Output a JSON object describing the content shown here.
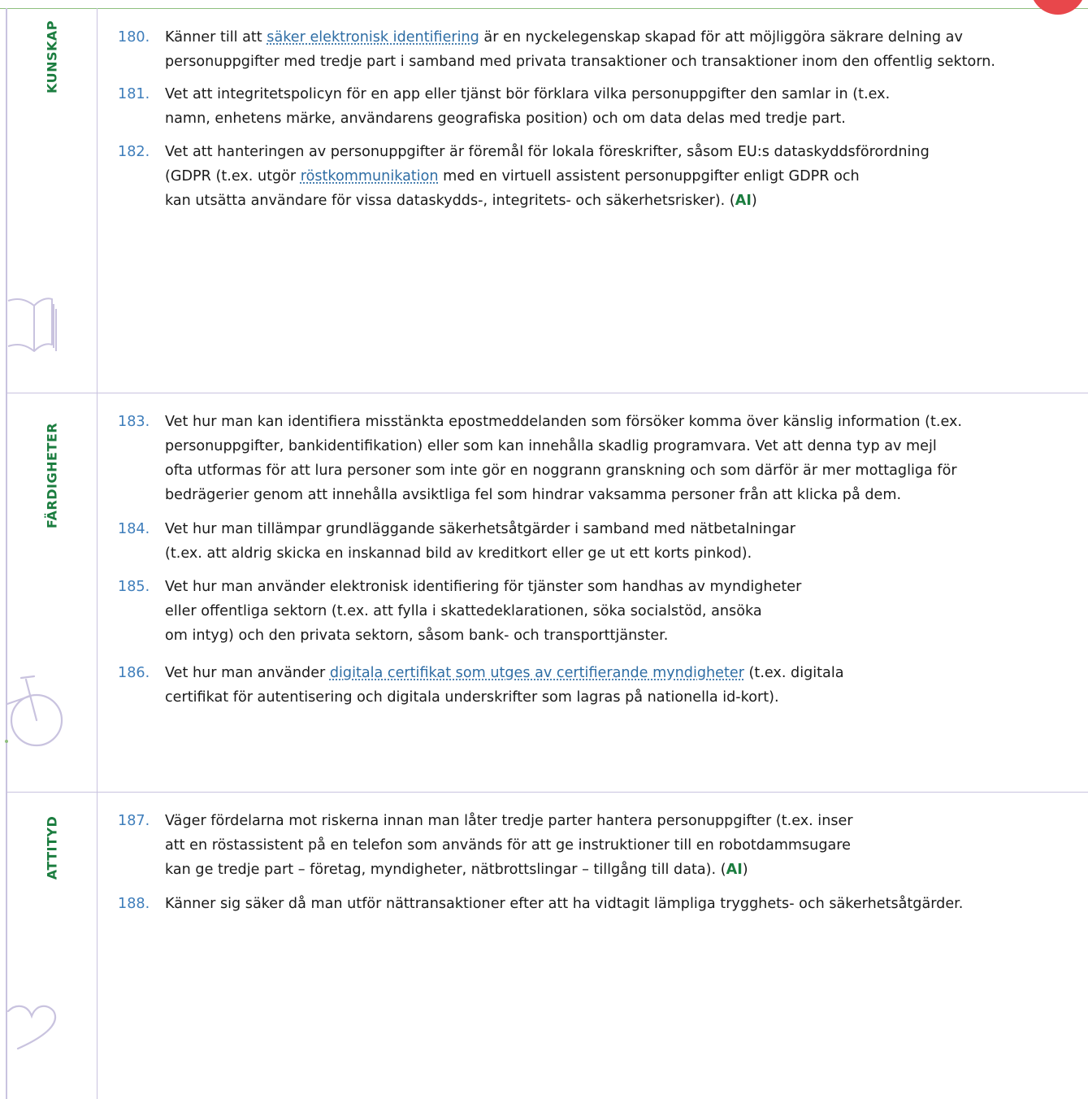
{
  "sections": {
    "kunskap": {
      "label": "KUNSKAP",
      "icon": "book-icon"
    },
    "fardigheter": {
      "label": "FÄRDIGHETER",
      "icon": "bicycle-icon"
    },
    "attityd": {
      "label": "ATTITYD",
      "icon": "heart-icon"
    }
  },
  "items": {
    "i180": {
      "num": "180.",
      "l1a": "Känner till att ",
      "l1link": "säker elektronisk identifiering",
      "l1b": " är en nyckelegenskap skapad för att möjliggöra säkrare delning av",
      "l2": "personuppgifter med tredje part i samband med privata transaktioner och transaktioner inom den offentlig sektorn."
    },
    "i181": {
      "num": "181.",
      "l1": "Vet att integritetspolicyn för en app eller tjänst bör förklara vilka personuppgifter den samlar in (t.ex.",
      "l2": "namn, enhetens märke, användarens geografiska position) och om data delas med tredje part."
    },
    "i182": {
      "num": "182.",
      "l1": "Vet att hanteringen av personuppgifter är föremål för lokala föreskrifter, såsom EU:s dataskyddsförordning",
      "l2a": "(GDPR (t.ex. utgör ",
      "l2link": "röstkommunikation",
      "l2b": " med en virtuell assistent personuppgifter enligt GDPR och",
      "l3a": "kan utsätta användare för vissa dataskydds-, integritets- och säkerhetsrisker). (",
      "ai": "AI",
      "l3b": ")"
    },
    "i183": {
      "num": "183.",
      "l1": "Vet hur man kan identifiera misstänkta epostmeddelanden som försöker komma över känslig information (t.ex.",
      "l2": "personuppgifter, bankidentifikation) eller som kan innehålla skadlig programvara. Vet att denna typ av mejl",
      "l3": "ofta utformas för att lura personer som inte gör en noggrann granskning och som därför är mer mottagliga för",
      "l4": "bedrägerier genom att innehålla avsiktliga fel som hindrar vaksamma personer från att klicka på dem."
    },
    "i184": {
      "num": "184.",
      "l1": "Vet hur man tillämpar grundläggande säkerhetsåtgärder i samband med nätbetalningar",
      "l2": "(t.ex. att aldrig skicka en inskannad bild av kreditkort eller ge ut ett korts pinkod)."
    },
    "i185": {
      "num": "185.",
      "l1": "Vet hur man använder elektronisk identifiering för tjänster som handhas av myndigheter",
      "l2": "eller offentliga sektorn (t.ex. att fylla i skattedeklarationen, söka socialstöd, ansöka",
      "l3": "om intyg) och den privata sektorn, såsom bank- och transporttjänster."
    },
    "i186": {
      "num": "186.",
      "l1a": "Vet hur man använder ",
      "l1link": "digitala certifikat som utges av certifierande myndigheter",
      "l1b": " (t.ex. digitala",
      "l2": "certifikat för autentisering och digitala underskrifter som lagras på nationella id-kort)."
    },
    "i187": {
      "num": "187.",
      "l1": "Väger fördelarna mot riskerna innan man låter tredje parter hantera personuppgifter (t.ex. inser",
      "l2": "att en röstassistent på en telefon som används för att ge instruktioner till en robotdammsugare",
      "l3a": "kan ge tredje part – företag, myndigheter, nätbrottslingar – tillgång till data). (",
      "ai": "AI",
      "l3b": ")"
    },
    "i188": {
      "num": "188.",
      "l1": "Känner sig säker då man utför nättransaktioner efter att ha vidtagit lämpliga trygghets- och säkerhetsåtgärder."
    }
  }
}
